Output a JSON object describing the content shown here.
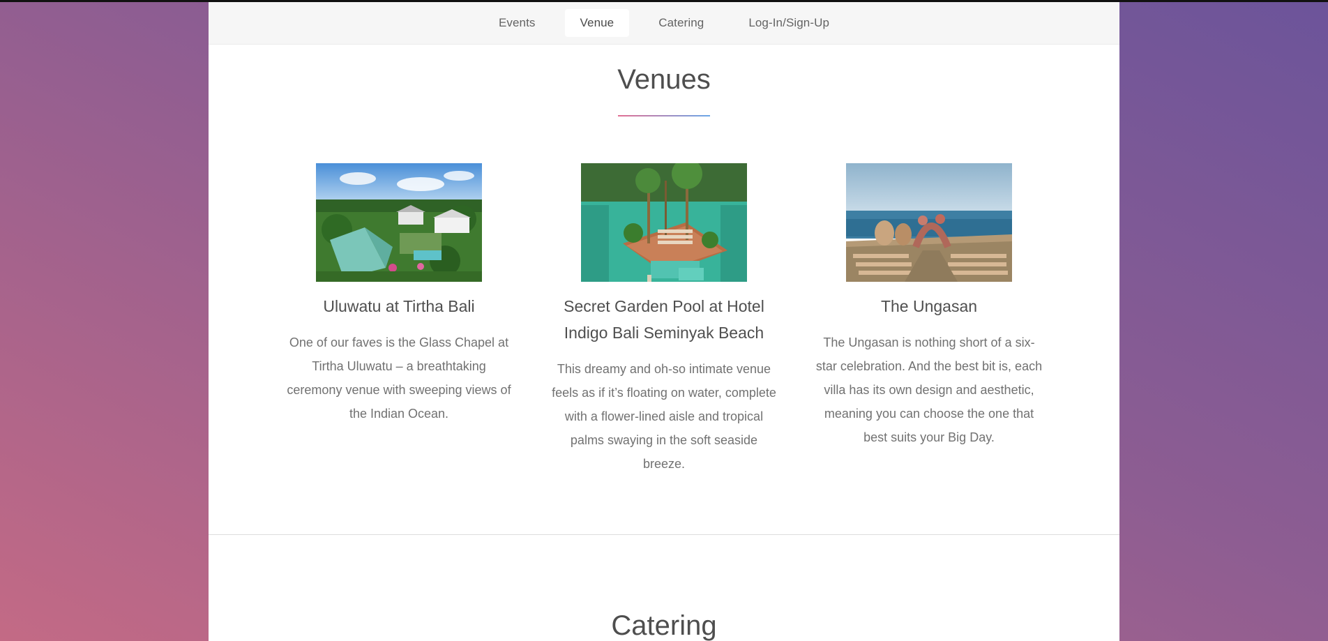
{
  "nav": {
    "items": [
      {
        "label": "Events"
      },
      {
        "label": "Venue"
      },
      {
        "label": "Catering"
      },
      {
        "label": "Log-In/Sign-Up"
      }
    ],
    "active": "Venue"
  },
  "venues_section": {
    "title": "Venues",
    "cards": [
      {
        "name": "Uluwatu at Tirtha Bali",
        "description": "One of our faves is the Glass Chapel at Tirtha Uluwatu – a breathtaking ceremony venue with sweeping views of the Indian Ocean."
      },
      {
        "name": "Secret Garden Pool at Hotel Indigo Bali Seminyak Beach",
        "description": "This dreamy and oh-so intimate venue feels as if it’s floating on water, complete with a flower-lined aisle and tropical palms swaying in the soft seaside breeze."
      },
      {
        "name": "The Ungasan",
        "description": "The Ungasan is nothing short of a six-star celebration. And the best bit is, each villa has its own design and aesthetic, meaning you can choose the one that best suits your Big Day."
      }
    ]
  },
  "catering_section": {
    "title": "Catering"
  },
  "colors": {
    "bg_gradient_left": "#c36a85",
    "bg_gradient_right": "#6c549a",
    "title_rule_left": "#e26f93",
    "title_rule_right": "#6aa7e8"
  }
}
